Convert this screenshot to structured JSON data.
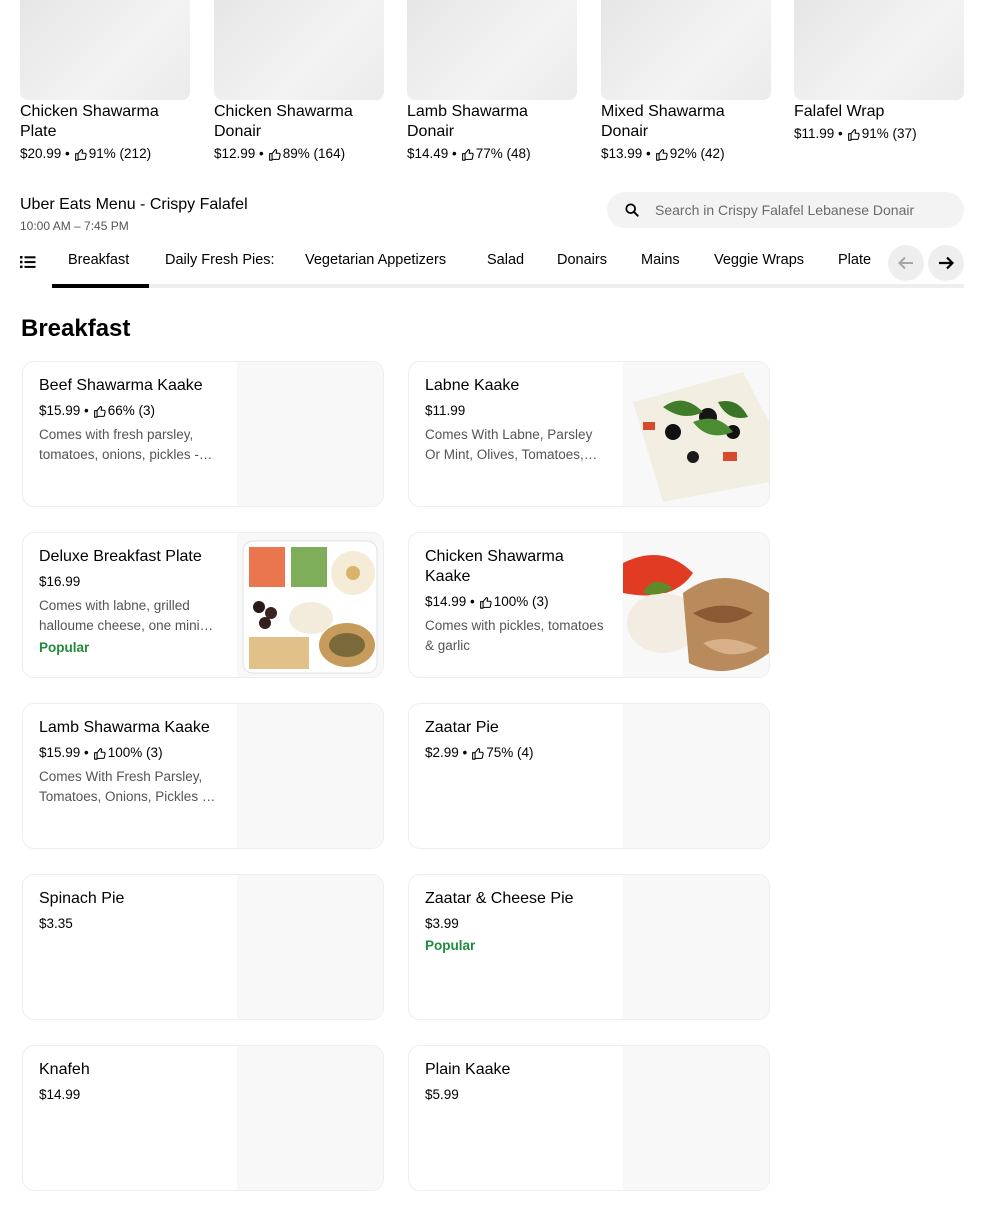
{
  "featured": [
    {
      "name": "Chicken Shawarma Plate",
      "price": "$20.99",
      "rating": "91% (212)"
    },
    {
      "name": "Chicken Shawarma Donair",
      "price": "$12.99",
      "rating": "89% (164)"
    },
    {
      "name": "Lamb Shawarma Donair",
      "price": "$14.49",
      "rating": "77% (48)"
    },
    {
      "name": "Mixed Shawarma Donair",
      "price": "$13.99",
      "rating": "92% (42)"
    },
    {
      "name": "Falafel Wrap",
      "price": "$11.99",
      "rating": "91% (37)"
    }
  ],
  "header": {
    "title": "Uber Eats Menu - Crispy Falafel",
    "hours": "10:00 AM – 7:45 PM"
  },
  "search": {
    "placeholder": "Search in Crispy Falafel Lebanese Donair"
  },
  "tabs": [
    {
      "label": "Breakfast",
      "active": true
    },
    {
      "label": "Daily Fresh Pies:"
    },
    {
      "label": "Vegetarian Appetizers"
    },
    {
      "label": "Salad"
    },
    {
      "label": "Donairs"
    },
    {
      "label": "Mains"
    },
    {
      "label": "Veggie Wraps"
    },
    {
      "label": "Plate"
    }
  ],
  "section": {
    "title": "Breakfast"
  },
  "items": [
    {
      "title": "Beef Shawarma Kaake",
      "price": "$15.99",
      "rating": "66% (3)",
      "desc": "Comes with fresh parsley, tomatoes, onions, pickles - tahini sauce",
      "image": "food-photo"
    },
    {
      "title": "Labne Kaake",
      "price": "$11.99",
      "desc": "Comes With Labne, Parsley Or Mint, Olives, Tomatoes, Cucumbers",
      "image": "food-photo"
    },
    {
      "title": "Deluxe Breakfast Plate",
      "price": "$16.99",
      "desc": "Comes with labne, grilled halloume cheese, one mini zaatar pie and veggies",
      "popular": "Popular",
      "image": "food-photo"
    },
    {
      "title": "Chicken Shawarma Kaake",
      "price": "$14.99",
      "rating": "100% (3)",
      "desc": "Comes with pickles, tomatoes & garlic",
      "image": "food-photo"
    },
    {
      "title": "Lamb Shawarma Kaake",
      "price": "$15.99",
      "rating": "100% (3)",
      "desc": "Comes With Fresh Parsley, Tomatoes, Onions, Pickles & Tahini"
    },
    {
      "title": "Zaatar Pie",
      "price": "$2.99",
      "rating": "75% (4)"
    },
    {
      "title": "Spinach Pie",
      "price": "$3.35"
    },
    {
      "title": "Zaatar & Cheese Pie",
      "price": "$3.99",
      "popular": "Popular"
    },
    {
      "title": "Knafeh",
      "price": "$14.99"
    },
    {
      "title": "Plain Kaake",
      "price": "$5.99"
    }
  ],
  "colors": {
    "popular": "#218a3c",
    "rail": "#eeeeee",
    "active_tab": "#000000"
  },
  "icons": [
    "thumbs-up-icon",
    "search-icon",
    "menu-list-icon",
    "arrow-left-icon",
    "arrow-right-icon"
  ]
}
